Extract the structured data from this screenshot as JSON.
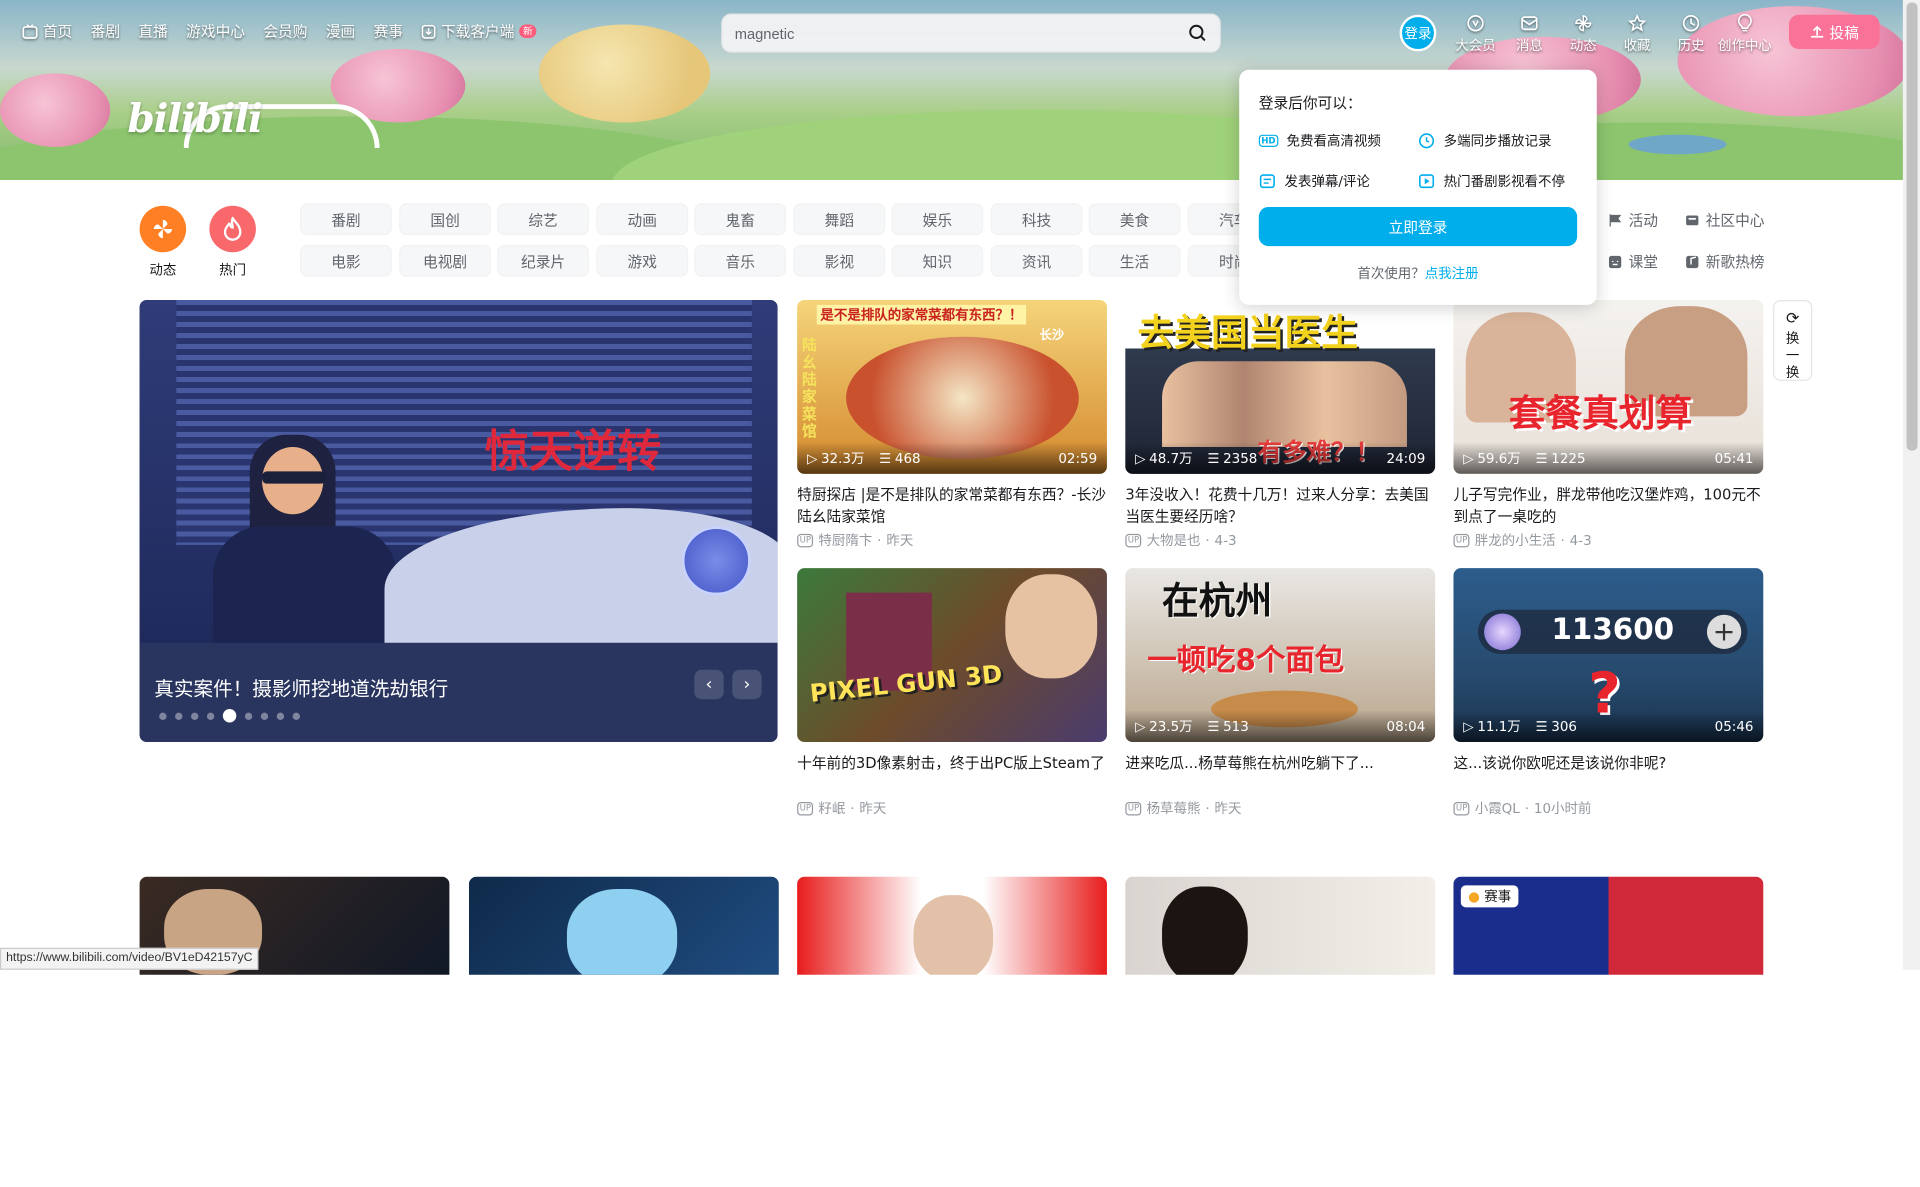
{
  "nav": {
    "left": [
      "首页",
      "番剧",
      "直播",
      "游戏中心",
      "会员购",
      "漫画",
      "赛事",
      "下载客户端"
    ],
    "new_badge": "新",
    "login": "登录",
    "right": [
      "大会员",
      "消息",
      "动态",
      "收藏",
      "历史",
      "创作中心"
    ],
    "upload": "投稿"
  },
  "search": {
    "value": "magnetic"
  },
  "channels": {
    "main": [
      "动态",
      "热门"
    ],
    "row1": [
      "番剧",
      "国创",
      "综艺",
      "动画",
      "鬼畜",
      "舞蹈",
      "娱乐",
      "科技",
      "美食",
      "汽车"
    ],
    "row2": [
      "电影",
      "电视剧",
      "纪录片",
      "游戏",
      "音乐",
      "影视",
      "知识",
      "资讯",
      "生活",
      "时尚"
    ],
    "side": [
      "活动",
      "社区中心",
      "课堂",
      "新歌热榜"
    ]
  },
  "popup": {
    "title": "登录后你可以：",
    "items": [
      "免费看高清视频",
      "多端同步播放记录",
      "发表弹幕/评论",
      "热门番剧影视看不停"
    ],
    "button": "立即登录",
    "register_prefix": "首次使用？",
    "register_link": "点我注册"
  },
  "carousel": {
    "title": "真实案件！摄影师挖地道洗劫银行",
    "overlay_text": "惊天逆转",
    "dots": 9,
    "active": 4
  },
  "refresh": {
    "label": "换一换"
  },
  "videos": [
    {
      "views": "32.3万",
      "danmaku": "468",
      "duration": "02:59",
      "title": "特厨探店 |是不是排队的家常菜都有东西？-长沙陆幺陆家菜馆",
      "author": "特厨隋卞",
      "date": "昨天",
      "thumb_text": "是不是排队的家常菜都有东西？！"
    },
    {
      "views": "48.7万",
      "danmaku": "2358",
      "duration": "24:09",
      "title": "3年没收入！花费十几万！过来人分享：去美国当医生要经历啥？",
      "author": "大物是也",
      "date": "4-3",
      "thumb_text": "去美国当医生"
    },
    {
      "views": "59.6万",
      "danmaku": "1225",
      "duration": "05:41",
      "title": "儿子写完作业，胖龙带他吃汉堡炸鸡，100元不到点了一桌吃的",
      "author": "胖龙的小生活",
      "date": "4-3",
      "thumb_text": "套餐真划算"
    },
    {
      "views": "",
      "danmaku": "",
      "duration": "",
      "title": "十年前的3D像素射击，终于出PC版上Steam了",
      "author": "籽岷",
      "date": "昨天",
      "thumb_text": "PIXEL GUN 3D"
    },
    {
      "views": "23.5万",
      "danmaku": "513",
      "duration": "08:04",
      "title": "进来吃瓜...杨草莓熊在杭州吃躺下了...",
      "author": "杨草莓熊",
      "date": "昨天",
      "thumb_text": "在杭州"
    },
    {
      "views": "11.1万",
      "danmaku": "306",
      "duration": "05:46",
      "title": "这...该说你欧呢还是该说你非呢?",
      "author": "小霞QL",
      "date": "10小时前",
      "thumb_text": "113600"
    }
  ],
  "thumb_extra": {
    "v0_side": "陆幺陆家菜馆",
    "v0_corner": "长沙",
    "v1_bottom": "有多难？！",
    "v4_sub": "一顿吃8个面包"
  },
  "bottom_badge": "赛事",
  "status_url": "https://www.bilibili.com/video/BV1eD42157yC",
  "logo": "bilibili"
}
